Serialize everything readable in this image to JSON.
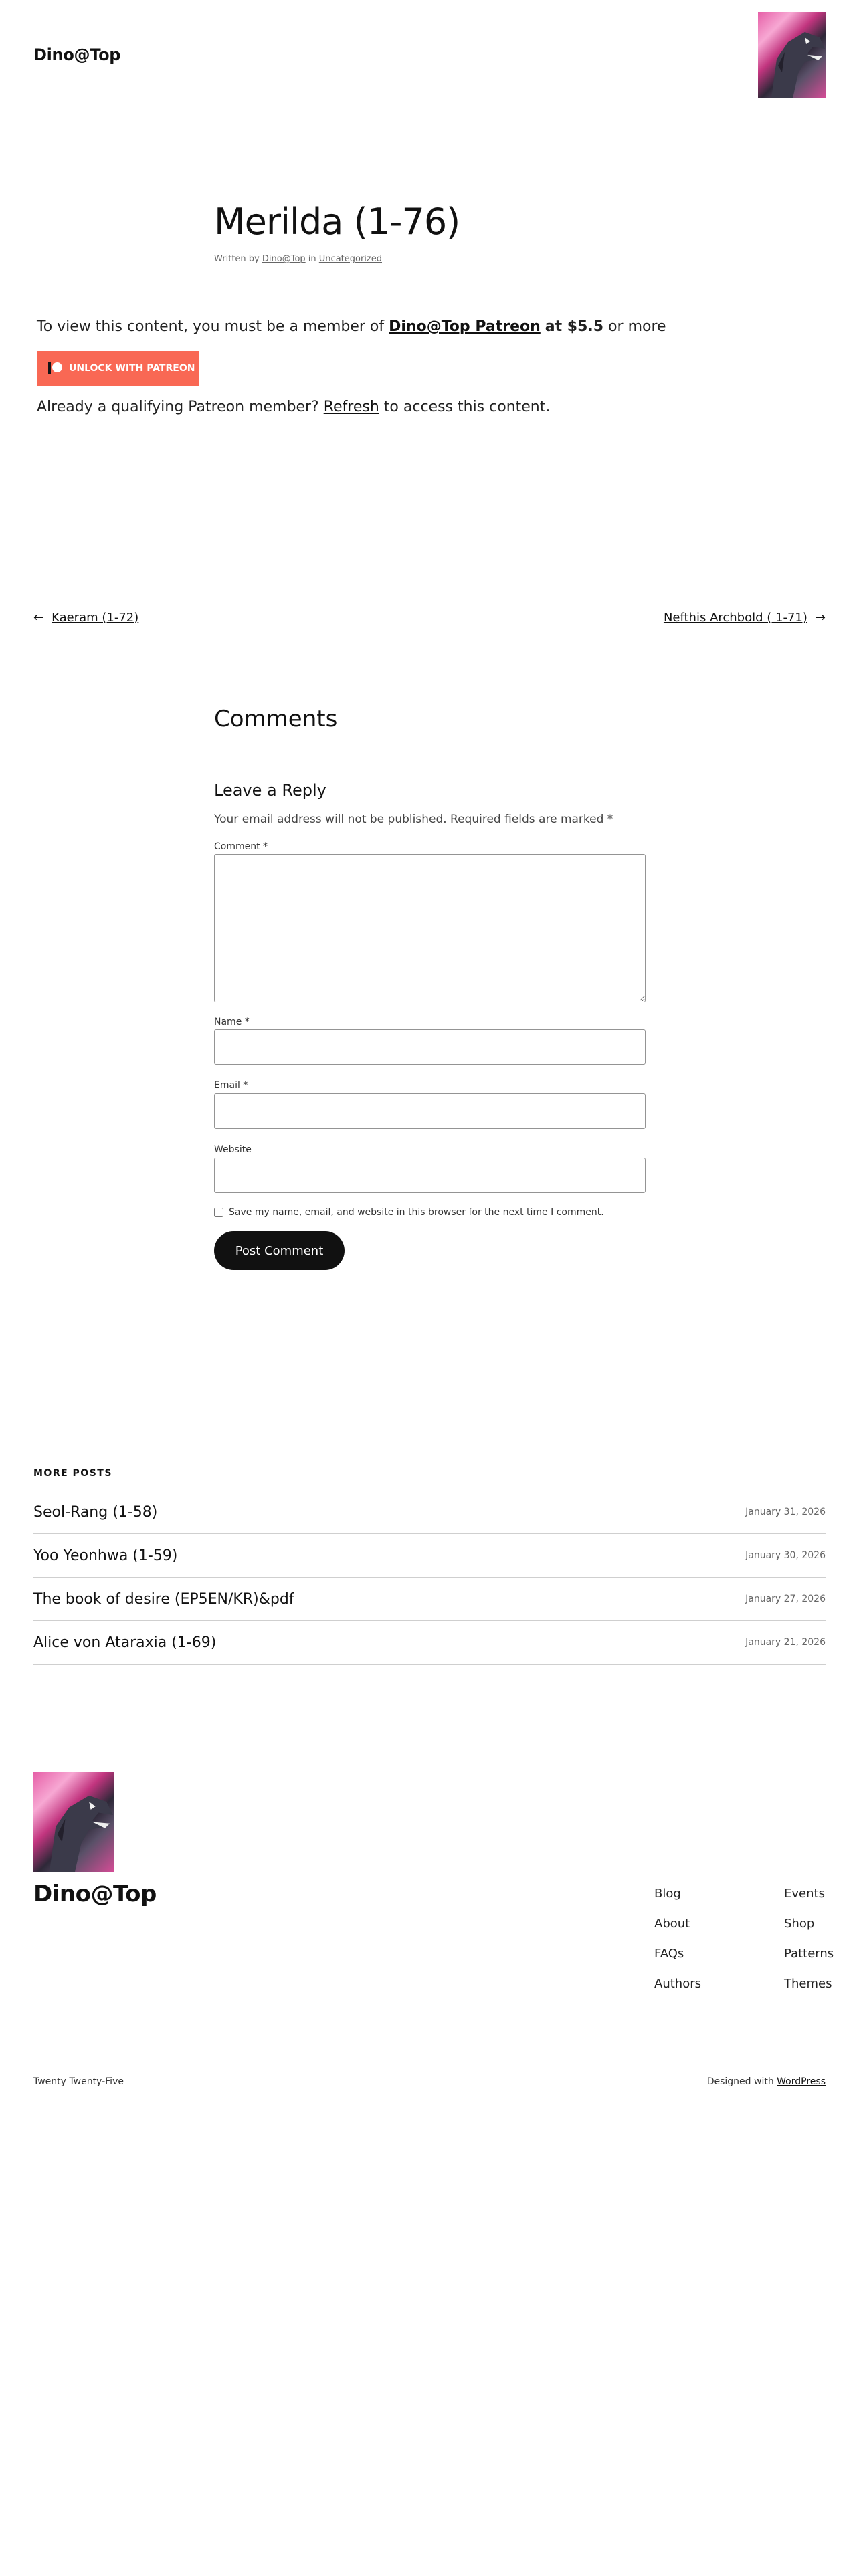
{
  "header": {
    "site_title": "Dino@Top",
    "logo_icon": "dragon-avatar"
  },
  "post": {
    "title": "Merilda (1-76)",
    "meta_prefix": "Written by",
    "author": "Dino@Top",
    "meta_in": "in",
    "category": "Uncategorized"
  },
  "patreon": {
    "view_prefix": "To view this content, you must be a member of",
    "patreon_name": "Dino@Top Patreon",
    "price": "at $5.5",
    "view_suffix": "or more",
    "unlock_label": "UNLOCK WITH PATREON",
    "already_prefix": "Already a qualifying Patreon member?",
    "refresh_label": "Refresh",
    "already_suffix": "to access this content.",
    "button_color": "#f96854"
  },
  "post_nav": {
    "prev_arrow": "←",
    "prev_label": "Kaeram (1-72)",
    "next_label": "Nefthis Archbold ( 1-71)",
    "next_arrow": "→"
  },
  "comments": {
    "heading": "Comments",
    "reply_heading": "Leave a Reply",
    "notes": "Your email address will not be published. Required fields are marked *",
    "comment_label": "Comment *",
    "name_label": "Name *",
    "email_label": "Email *",
    "website_label": "Website",
    "save_label": "Save my name, email, and website in this browser for the next time I comment.",
    "submit_label": "Post Comment"
  },
  "more_posts": {
    "title": "MORE POSTS",
    "items": [
      {
        "title": "Seol-Rang (1-58)",
        "date": "January 31, 2026"
      },
      {
        "title": "Yoo Yeonhwa (1-59)",
        "date": "January 30, 2026"
      },
      {
        "title": "The book of desire (EP5EN/KR)&pdf",
        "date": "January 27, 2026"
      },
      {
        "title": "Alice von Ataraxia (1-69)",
        "date": "January 21, 2026"
      }
    ]
  },
  "footer": {
    "site_title": "Dino@Top",
    "nav_col1": [
      "Blog",
      "About",
      "FAQs",
      "Authors"
    ],
    "nav_col2": [
      "Events",
      "Shop",
      "Patterns",
      "Themes"
    ],
    "theme_name": "Twenty Twenty-Five",
    "designed_prefix": "Designed with",
    "designed_link": "WordPress"
  }
}
